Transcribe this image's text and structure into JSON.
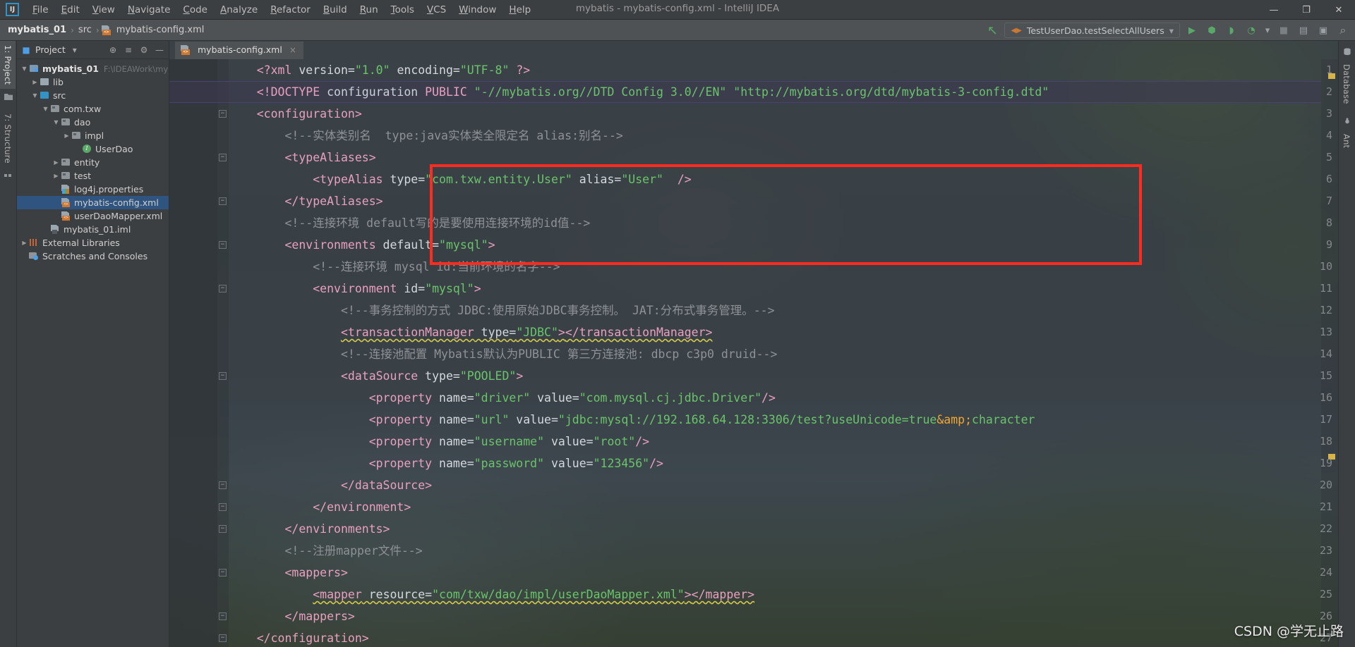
{
  "window": {
    "title": "mybatis - mybatis-config.xml - IntelliJ IDEA",
    "minimize": "—",
    "maximize": "❐",
    "close": "✕",
    "logo": "IJ"
  },
  "menu": {
    "items": [
      "File",
      "Edit",
      "View",
      "Navigate",
      "Code",
      "Analyze",
      "Refactor",
      "Build",
      "Run",
      "Tools",
      "VCS",
      "Window",
      "Help"
    ]
  },
  "breadcrumb": {
    "project": "mybatis_01",
    "sep": "›",
    "src": "src",
    "file": "mybatis-config.xml"
  },
  "toolbar": {
    "run_config": "TestUserDao.testSelectAllUsers",
    "run_config_caret": "▾",
    "back_arrow": "↖",
    "run": "▶",
    "debug": "⬢",
    "run_coverage": "◗",
    "profile": "◔",
    "profile_caret": "▾",
    "stop": "■",
    "project_structure": "▤",
    "terminal": "▣",
    "search": "⌕"
  },
  "left_strip": {
    "project_tab": "1: Project",
    "structure_tab": "7: Structure"
  },
  "right_strip": {
    "database_tab": "Database",
    "ant_tab": "Ant"
  },
  "project_panel": {
    "title": "Project",
    "title_caret": "▾",
    "locate_icon": "⊕",
    "collapse_icon": "≡",
    "settings_icon": "⚙",
    "hide_icon": "—",
    "tree": [
      {
        "depth": 0,
        "arrow": "▼",
        "icon": "mod",
        "name": "mybatis_01",
        "bold": true,
        "path": "F:\\IDEAWork\\myba",
        "selected": false
      },
      {
        "depth": 1,
        "arrow": "▶",
        "icon": "plain",
        "name": "lib",
        "bold": false,
        "path": "",
        "selected": false
      },
      {
        "depth": 1,
        "arrow": "▼",
        "icon": "src",
        "name": "src",
        "bold": false,
        "path": "",
        "selected": false
      },
      {
        "depth": 2,
        "arrow": "▼",
        "icon": "pkg",
        "name": "com.txw",
        "bold": false,
        "path": "",
        "selected": false
      },
      {
        "depth": 3,
        "arrow": "▼",
        "icon": "pkg",
        "name": "dao",
        "bold": false,
        "path": "",
        "selected": false
      },
      {
        "depth": 4,
        "arrow": "▶",
        "icon": "pkg",
        "name": "impl",
        "bold": false,
        "path": "",
        "selected": false
      },
      {
        "depth": 5,
        "arrow": "",
        "icon": "iface",
        "name": "UserDao",
        "bold": false,
        "path": "",
        "selected": false
      },
      {
        "depth": 3,
        "arrow": "▶",
        "icon": "pkg",
        "name": "entity",
        "bold": false,
        "path": "",
        "selected": false
      },
      {
        "depth": 3,
        "arrow": "▶",
        "icon": "pkg",
        "name": "test",
        "bold": false,
        "path": "",
        "selected": false
      },
      {
        "depth": 3,
        "arrow": "",
        "icon": "props",
        "name": "log4j.properties",
        "bold": false,
        "path": "",
        "selected": false
      },
      {
        "depth": 3,
        "arrow": "",
        "icon": "xml",
        "name": "mybatis-config.xml",
        "bold": false,
        "path": "",
        "selected": true
      },
      {
        "depth": 3,
        "arrow": "",
        "icon": "xml",
        "name": "userDaoMapper.xml",
        "bold": false,
        "path": "",
        "selected": false
      },
      {
        "depth": 2,
        "arrow": "",
        "icon": "iml",
        "name": "mybatis_01.iml",
        "bold": false,
        "path": "",
        "selected": false
      },
      {
        "depth": 0,
        "arrow": "▶",
        "icon": "lib",
        "name": "External Libraries",
        "bold": false,
        "path": "",
        "selected": false
      },
      {
        "depth": 0,
        "arrow": "",
        "icon": "scratch",
        "name": "Scratches and Consoles",
        "bold": false,
        "path": "",
        "selected": false
      }
    ]
  },
  "editor": {
    "tab_label": "mybatis-config.xml",
    "tab_close": "×",
    "annotation": {
      "label": "red-highlight-box",
      "color": "#ff2b1f",
      "wraps_lines": [
        4,
        5,
        6,
        7
      ]
    },
    "lines": [
      {
        "n": 1,
        "highlight": false,
        "tokens": [
          {
            "t": "    ",
            "c": "pl"
          },
          {
            "t": "<?xml ",
            "c": "tg"
          },
          {
            "t": "version=",
            "c": "at"
          },
          {
            "t": "\"1.0\"",
            "c": "st"
          },
          {
            "t": " encoding=",
            "c": "at"
          },
          {
            "t": "\"UTF-8\"",
            "c": "st"
          },
          {
            "t": " ?>",
            "c": "tg"
          }
        ]
      },
      {
        "n": 2,
        "highlight": true,
        "tokens": [
          {
            "t": "    ",
            "c": "pl"
          },
          {
            "t": "<!DOCTYPE",
            "c": "tg"
          },
          {
            "t": " configuration ",
            "c": "pl"
          },
          {
            "t": "PUBLIC",
            "c": "tg"
          },
          {
            "t": " ",
            "c": "pl"
          },
          {
            "t": "\"-//mybatis.org//DTD Config 3.0//EN\"",
            "c": "st"
          },
          {
            "t": " ",
            "c": "pl"
          },
          {
            "t": "\"http://mybatis.org/dtd/mybatis-3-config.dtd\"",
            "c": "st"
          }
        ]
      },
      {
        "n": 3,
        "highlight": false,
        "tokens": [
          {
            "t": "    ",
            "c": "pl"
          },
          {
            "t": "<configuration>",
            "c": "tg"
          }
        ]
      },
      {
        "n": 4,
        "highlight": false,
        "tokens": [
          {
            "t": "        ",
            "c": "pl"
          },
          {
            "t": "<!--实体类别名  type:java实体类全限定名 alias:别名-->",
            "c": "cm"
          }
        ]
      },
      {
        "n": 5,
        "highlight": false,
        "tokens": [
          {
            "t": "        ",
            "c": "pl"
          },
          {
            "t": "<typeAliases>",
            "c": "tg"
          }
        ]
      },
      {
        "n": 6,
        "highlight": false,
        "tokens": [
          {
            "t": "            ",
            "c": "pl"
          },
          {
            "t": "<typeAlias",
            "c": "tg"
          },
          {
            "t": " type=",
            "c": "at"
          },
          {
            "t": "\"com.txw.entity.User\"",
            "c": "st"
          },
          {
            "t": " alias=",
            "c": "at"
          },
          {
            "t": "\"User\"",
            "c": "st"
          },
          {
            "t": "  />",
            "c": "tg"
          }
        ]
      },
      {
        "n": 7,
        "highlight": false,
        "tokens": [
          {
            "t": "        ",
            "c": "pl"
          },
          {
            "t": "</typeAliases>",
            "c": "tg"
          }
        ]
      },
      {
        "n": 8,
        "highlight": false,
        "tokens": [
          {
            "t": "        ",
            "c": "pl"
          },
          {
            "t": "<!--连接环境 default写的是要使用连接环境的id值-->",
            "c": "cm"
          }
        ]
      },
      {
        "n": 9,
        "highlight": false,
        "tokens": [
          {
            "t": "        ",
            "c": "pl"
          },
          {
            "t": "<environments",
            "c": "tg"
          },
          {
            "t": " default=",
            "c": "at"
          },
          {
            "t": "\"mysql\"",
            "c": "st"
          },
          {
            "t": ">",
            "c": "tg"
          }
        ]
      },
      {
        "n": 10,
        "highlight": false,
        "tokens": [
          {
            "t": "            ",
            "c": "pl"
          },
          {
            "t": "<!--连接环境 mysql id:当前环境的名字-->",
            "c": "cm"
          }
        ]
      },
      {
        "n": 11,
        "highlight": false,
        "tokens": [
          {
            "t": "            ",
            "c": "pl"
          },
          {
            "t": "<environment",
            "c": "tg"
          },
          {
            "t": " id=",
            "c": "at"
          },
          {
            "t": "\"mysql\"",
            "c": "st"
          },
          {
            "t": ">",
            "c": "tg"
          }
        ]
      },
      {
        "n": 12,
        "highlight": false,
        "tokens": [
          {
            "t": "                ",
            "c": "pl"
          },
          {
            "t": "<!--事务控制的方式 JDBC:使用原始JDBC事务控制。 JAT:分布式事务管理。-->",
            "c": "cm"
          }
        ]
      },
      {
        "n": 13,
        "highlight": false,
        "tokens": [
          {
            "t": "                ",
            "c": "pl"
          },
          {
            "t": "<transactionManager",
            "c": "tg wavy"
          },
          {
            "t": " type=",
            "c": "at wavy"
          },
          {
            "t": "\"JDBC\"",
            "c": "st wavy"
          },
          {
            "t": ">",
            "c": "tg wavy"
          },
          {
            "t": "</transactionManager>",
            "c": "tg wavy"
          }
        ]
      },
      {
        "n": 14,
        "highlight": false,
        "tokens": [
          {
            "t": "                ",
            "c": "pl"
          },
          {
            "t": "<!--连接池配置 Mybatis默认为PUBLIC 第三方连接池: dbcp c3p0 druid-->",
            "c": "cm"
          }
        ]
      },
      {
        "n": 15,
        "highlight": false,
        "tokens": [
          {
            "t": "                ",
            "c": "pl"
          },
          {
            "t": "<dataSource",
            "c": "tg"
          },
          {
            "t": " type=",
            "c": "at"
          },
          {
            "t": "\"POOLED\"",
            "c": "st"
          },
          {
            "t": ">",
            "c": "tg"
          }
        ]
      },
      {
        "n": 16,
        "highlight": false,
        "tokens": [
          {
            "t": "                    ",
            "c": "pl"
          },
          {
            "t": "<property",
            "c": "tg"
          },
          {
            "t": " name=",
            "c": "at"
          },
          {
            "t": "\"driver\"",
            "c": "st"
          },
          {
            "t": " value=",
            "c": "at"
          },
          {
            "t": "\"com.mysql.cj.jdbc.Driver\"",
            "c": "st"
          },
          {
            "t": "/>",
            "c": "tg"
          }
        ]
      },
      {
        "n": 17,
        "highlight": false,
        "tokens": [
          {
            "t": "                    ",
            "c": "pl"
          },
          {
            "t": "<property",
            "c": "tg"
          },
          {
            "t": " name=",
            "c": "at"
          },
          {
            "t": "\"url\"",
            "c": "st"
          },
          {
            "t": " value=",
            "c": "at"
          },
          {
            "t": "\"jdbc:mysql://192.168.64.128:3306/test?useUnicode=true",
            "c": "st"
          },
          {
            "t": "&amp;",
            "c": "ent"
          },
          {
            "t": "character",
            "c": "st"
          }
        ]
      },
      {
        "n": 18,
        "highlight": false,
        "tokens": [
          {
            "t": "                    ",
            "c": "pl"
          },
          {
            "t": "<property",
            "c": "tg"
          },
          {
            "t": " name=",
            "c": "at"
          },
          {
            "t": "\"username\"",
            "c": "st"
          },
          {
            "t": " value=",
            "c": "at"
          },
          {
            "t": "\"root\"",
            "c": "st"
          },
          {
            "t": "/>",
            "c": "tg"
          }
        ]
      },
      {
        "n": 19,
        "highlight": false,
        "tokens": [
          {
            "t": "                    ",
            "c": "pl"
          },
          {
            "t": "<property",
            "c": "tg"
          },
          {
            "t": " name=",
            "c": "at"
          },
          {
            "t": "\"password\"",
            "c": "st"
          },
          {
            "t": " value=",
            "c": "at"
          },
          {
            "t": "\"123456\"",
            "c": "st"
          },
          {
            "t": "/>",
            "c": "tg"
          }
        ]
      },
      {
        "n": 20,
        "highlight": false,
        "tokens": [
          {
            "t": "                ",
            "c": "pl"
          },
          {
            "t": "</dataSource>",
            "c": "tg"
          }
        ]
      },
      {
        "n": 21,
        "highlight": false,
        "tokens": [
          {
            "t": "            ",
            "c": "pl"
          },
          {
            "t": "</environment>",
            "c": "tg"
          }
        ]
      },
      {
        "n": 22,
        "highlight": false,
        "tokens": [
          {
            "t": "        ",
            "c": "pl"
          },
          {
            "t": "</environments>",
            "c": "tg"
          }
        ]
      },
      {
        "n": 23,
        "highlight": false,
        "tokens": [
          {
            "t": "        ",
            "c": "pl"
          },
          {
            "t": "<!--注册mapper文件-->",
            "c": "cm"
          }
        ]
      },
      {
        "n": 24,
        "highlight": false,
        "tokens": [
          {
            "t": "        ",
            "c": "pl"
          },
          {
            "t": "<mappers>",
            "c": "tg"
          }
        ]
      },
      {
        "n": 25,
        "highlight": false,
        "tokens": [
          {
            "t": "            ",
            "c": "pl"
          },
          {
            "t": "<mapper",
            "c": "tg wavy"
          },
          {
            "t": " resource=",
            "c": "at wavy"
          },
          {
            "t": "\"com/txw/dao/impl/userDaoMapper.xml\"",
            "c": "st wavy"
          },
          {
            "t": ">",
            "c": "tg wavy"
          },
          {
            "t": "</mapper>",
            "c": "tg wavy"
          }
        ]
      },
      {
        "n": 26,
        "highlight": false,
        "tokens": [
          {
            "t": "        ",
            "c": "pl"
          },
          {
            "t": "</mappers>",
            "c": "tg"
          }
        ]
      },
      {
        "n": 27,
        "highlight": false,
        "tokens": [
          {
            "t": "    ",
            "c": "pl"
          },
          {
            "t": "</configuration>",
            "c": "tg"
          }
        ]
      }
    ]
  },
  "watermark": "CSDN @学无止路",
  "colors": {
    "accent_blue": "#3592c4",
    "selection": "#2f5480",
    "tag_pink": "#e8a0bf",
    "string_green": "#6ac46a",
    "comment_grey": "#8e9196",
    "entity_orange": "#f0a732",
    "red_box": "#ff2b1f",
    "chrome": "#3c3f41"
  }
}
